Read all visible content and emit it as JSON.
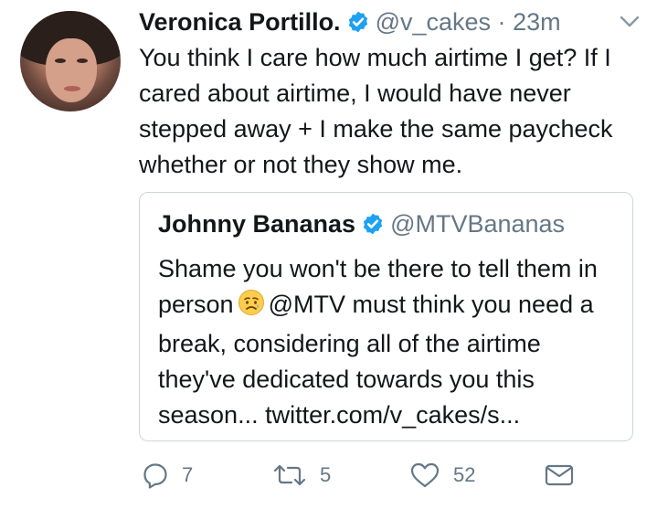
{
  "tweet": {
    "author_name": "Veronica Portillo.",
    "handle": "@v_cakes",
    "separator": "·",
    "time": "23m",
    "text": "You think I care how much airtime I get? If I cared about airtime, I would have never stepped away + I make the same paycheck whether or not they show me."
  },
  "quoted": {
    "author_name": "Johnny Bananas",
    "handle": "@MTVBananas",
    "text_before_emoji": "Shame you won't be there to tell them in person",
    "text_after_emoji": "@MTV must think you need a break, considering all of the airtime they've dedicated towards you this season... twitter.com/v_cakes/s..."
  },
  "actions": {
    "reply_count": "7",
    "retweet_count": "5",
    "like_count": "52"
  },
  "colors": {
    "text": "#14171a",
    "secondary": "#657786",
    "verified": "#1da1f2",
    "border": "#ccd6dd"
  },
  "icons": [
    "verified-badge-icon",
    "chevron-down-icon",
    "worried-face-emoji",
    "reply-icon",
    "retweet-icon",
    "like-icon",
    "direct-message-icon"
  ]
}
